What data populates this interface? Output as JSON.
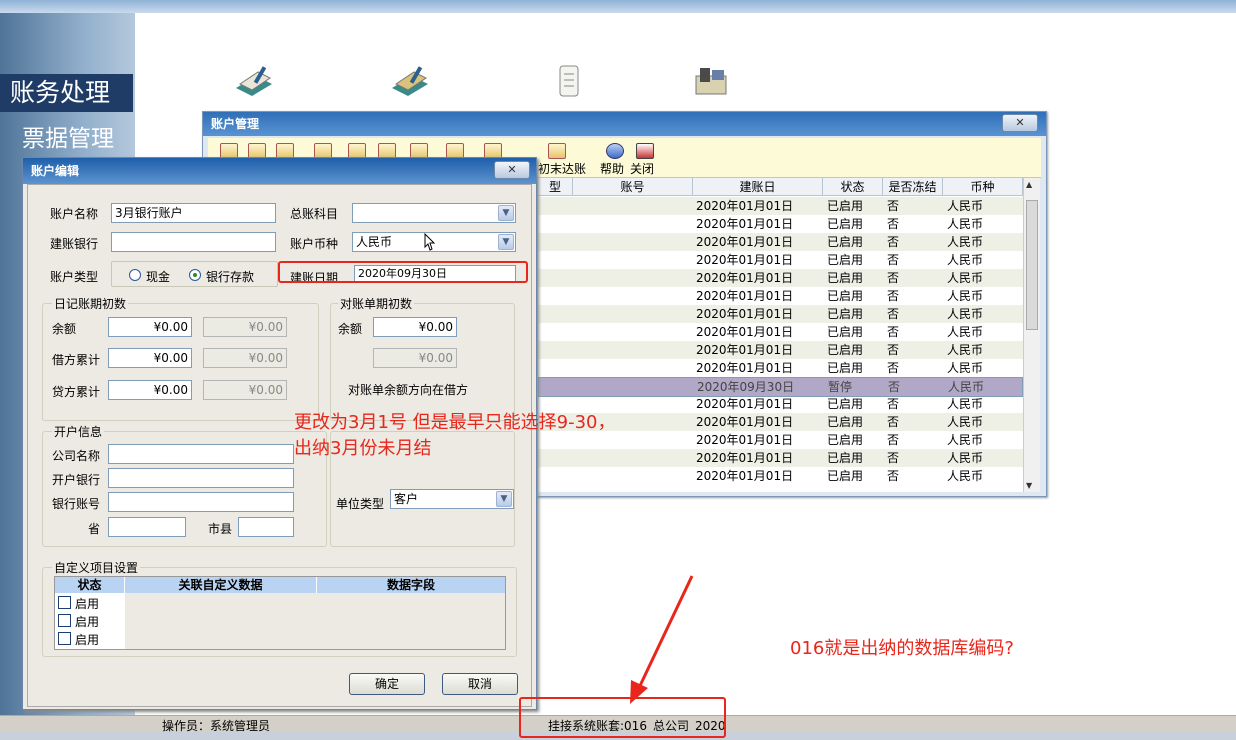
{
  "sidebar": {
    "nav_primary": "账务处理",
    "nav_secondary": "票据管理"
  },
  "account_manager": {
    "title": "账户管理",
    "toolbar_labels": {
      "period_end_reconcile": "初末达账",
      "help": "帮助",
      "close": "关闭"
    },
    "columns": [
      "型",
      "账号",
      "建账日",
      "状态",
      "是否冻结",
      "币种"
    ],
    "rows": [
      {
        "date": "2020年01月01日",
        "status": "已启用",
        "frozen": "否",
        "currency": "人民币"
      },
      {
        "date": "2020年01月01日",
        "status": "已启用",
        "frozen": "否",
        "currency": "人民币"
      },
      {
        "date": "2020年01月01日",
        "status": "已启用",
        "frozen": "否",
        "currency": "人民币"
      },
      {
        "date": "2020年01月01日",
        "status": "已启用",
        "frozen": "否",
        "currency": "人民币"
      },
      {
        "date": "2020年01月01日",
        "status": "已启用",
        "frozen": "否",
        "currency": "人民币"
      },
      {
        "date": "2020年01月01日",
        "status": "已启用",
        "frozen": "否",
        "currency": "人民币"
      },
      {
        "date": "2020年01月01日",
        "status": "已启用",
        "frozen": "否",
        "currency": "人民币"
      },
      {
        "date": "2020年01月01日",
        "status": "已启用",
        "frozen": "否",
        "currency": "人民币"
      },
      {
        "date": "2020年01月01日",
        "status": "已启用",
        "frozen": "否",
        "currency": "人民币"
      },
      {
        "date": "2020年01月01日",
        "status": "已启用",
        "frozen": "否",
        "currency": "人民币"
      },
      {
        "date": "2020年09月30日",
        "status": "暂停",
        "frozen": "否",
        "currency": "人民币"
      },
      {
        "date": "2020年01月01日",
        "status": "已启用",
        "frozen": "否",
        "currency": "人民币"
      },
      {
        "date": "2020年01月01日",
        "status": "已启用",
        "frozen": "否",
        "currency": "人民币"
      },
      {
        "date": "2020年01月01日",
        "status": "已启用",
        "frozen": "否",
        "currency": "人民币"
      },
      {
        "date": "2020年01月01日",
        "status": "已启用",
        "frozen": "否",
        "currency": "人民币"
      },
      {
        "date": "2020年01月01日",
        "status": "已启用",
        "frozen": "否",
        "currency": "人民币"
      }
    ]
  },
  "account_edit": {
    "title": "账户编辑",
    "account_name_label": "账户名称",
    "account_name_value": "3月银行账户",
    "bank_label": "建账银行",
    "bank_value": "",
    "ledger_subject_label": "总账科目",
    "ledger_subject_value": "",
    "currency_label": "账户币种",
    "currency_value": "人民币",
    "account_type_label": "账户类型",
    "type_cash": "现金",
    "type_bank": "银行存款",
    "open_date_label": "建账日期",
    "open_date_value": "2020年09月30日",
    "journal_group": "日记账期初数",
    "balance_label": "余额",
    "debit_total_label": "借方累计",
    "credit_total_label": "贷方累计",
    "zero": "¥0.00",
    "statement_group": "对账单期初数",
    "statement_balance_label": "余额",
    "statement_direction": "对账单余额方向在借方",
    "opening_info_group": "开户信息",
    "company_label": "公司名称",
    "open_bank_label": "开户银行",
    "bank_account_label": "银行账号",
    "province_label": "省",
    "city_label": "市县",
    "unit_type_label": "单位类型",
    "unit_type_value": "客户",
    "custom_group": "自定义项目设置",
    "custom_columns": [
      "状态",
      "关联自定义数据",
      "数据字段"
    ],
    "custom_rows": [
      "启用",
      "启用",
      "启用"
    ],
    "ok_button": "确定",
    "cancel_button": "取消"
  },
  "status_bar": {
    "operator": "操作员：系统管理员",
    "account_set": "挂接系统账套:016_总公司_2020"
  },
  "annotations": {
    "note1_line1": "更改为3月1号 但是最早只能选择9-30，",
    "note1_line2": "出纳3月份未月结",
    "note2": "016就是出纳的数据库编码?"
  },
  "colors": {
    "annotation": "#e8261c",
    "title_bar": "#2f6fb8",
    "selected_row": "#b0a8c6"
  }
}
